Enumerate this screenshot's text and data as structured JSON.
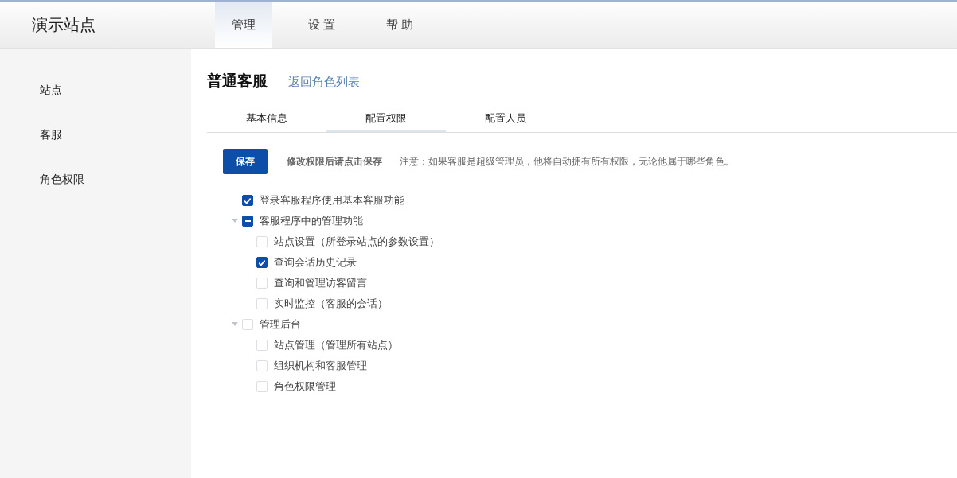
{
  "header": {
    "site_name": "演示站点",
    "nav": [
      {
        "label": "管理",
        "selected": true
      },
      {
        "label": "设 置",
        "selected": false
      },
      {
        "label": "帮 助",
        "selected": false
      }
    ]
  },
  "sidebar": {
    "items": [
      {
        "label": "站点"
      },
      {
        "label": "客服"
      },
      {
        "label": "角色权限"
      }
    ]
  },
  "page": {
    "title": "普通客服",
    "back_link": "返回角色列表",
    "tabs": [
      {
        "label": "基本信息",
        "selected": false
      },
      {
        "label": "配置权限",
        "selected": true
      },
      {
        "label": "配置人员",
        "selected": false
      }
    ],
    "save_button": "保存",
    "save_hint": "修改权限后请点击保存",
    "notice": "注意：如果客服是超级管理员，他将自动拥有所有权限，无论他属于哪些角色。",
    "permissions": [
      {
        "label": "登录客服程序使用基本客服功能",
        "checked": true,
        "partial": false
      },
      {
        "label": "客服程序中的管理功能",
        "checked": false,
        "partial": true,
        "expanded": true,
        "children": [
          {
            "label": "站点设置（所登录站点的参数设置）",
            "checked": false,
            "partial": false
          },
          {
            "label": "查询会话历史记录",
            "checked": true,
            "partial": false
          },
          {
            "label": "查询和管理访客留言",
            "checked": false,
            "partial": false
          },
          {
            "label": "实时监控（客服的会话）",
            "checked": false,
            "partial": false
          }
        ]
      },
      {
        "label": "管理后台",
        "checked": false,
        "partial": false,
        "expanded": true,
        "children": [
          {
            "label": "站点管理（管理所有站点）",
            "checked": false,
            "partial": false
          },
          {
            "label": "组织机构和客服管理",
            "checked": false,
            "partial": false
          },
          {
            "label": "角色权限管理",
            "checked": false,
            "partial": false
          }
        ]
      }
    ]
  }
}
